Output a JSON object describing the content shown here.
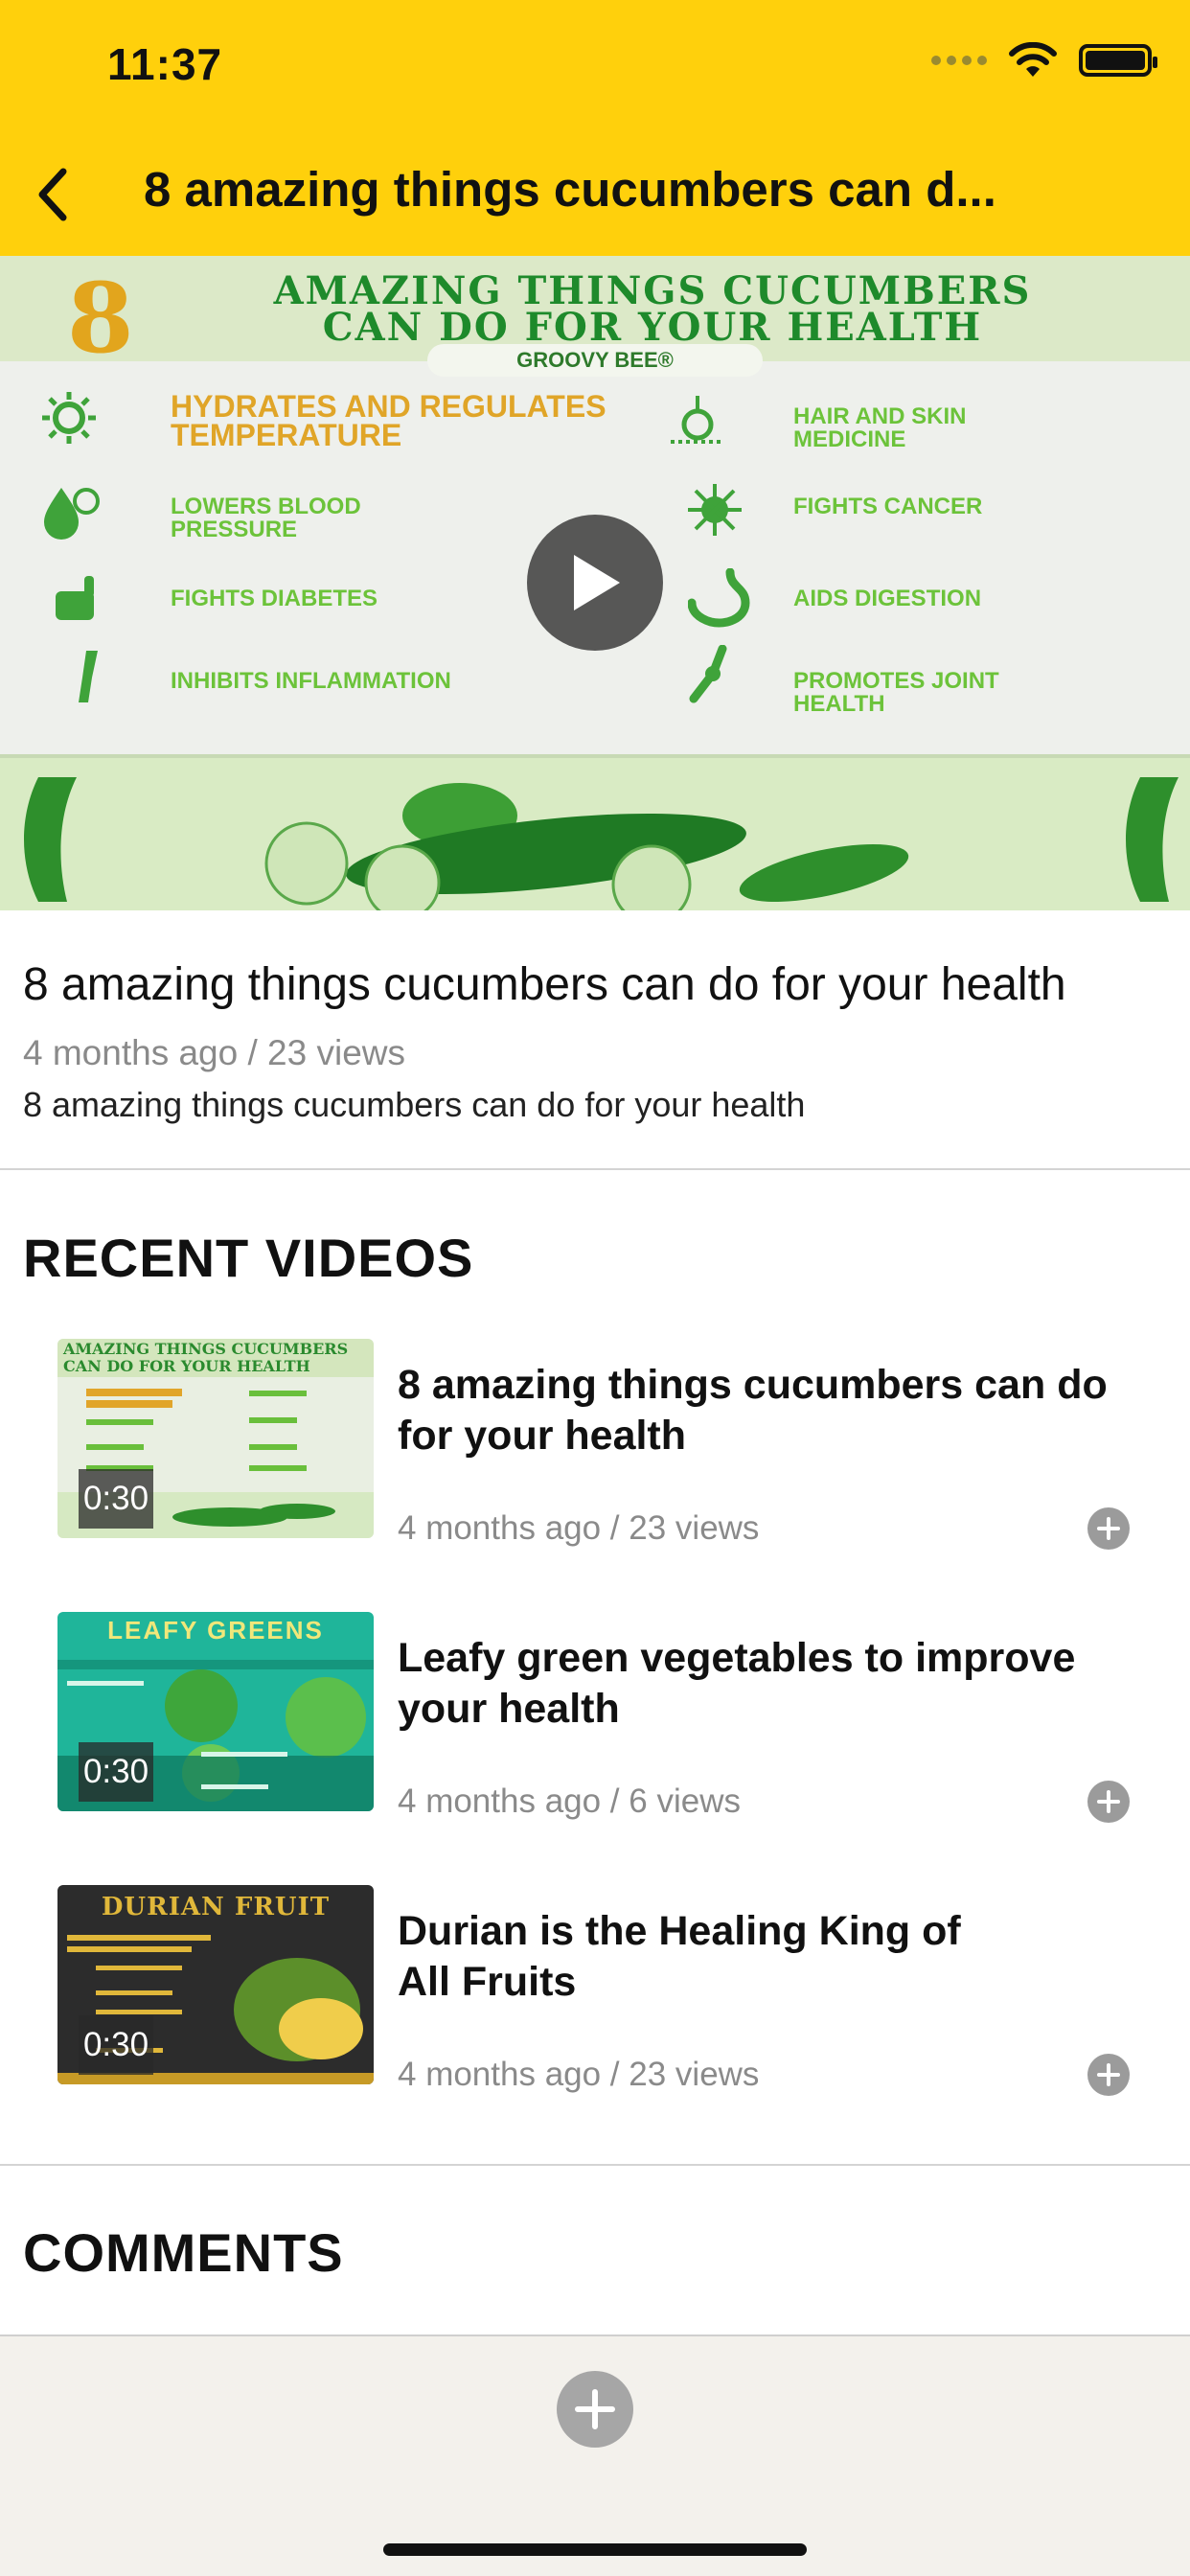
{
  "status_bar": {
    "time": "11:37"
  },
  "nav": {
    "title": "8 amazing things cucumbers can d..."
  },
  "hero": {
    "poster": {
      "number": "8",
      "title_line1": "AMAZING THINGS CUCUMBERS",
      "title_line2": "CAN DO FOR YOUR HEALTH",
      "brand": "GROOVY BEE®",
      "benefits_left": [
        "HYDRATES AND REGULATES TEMPERATURE",
        "LOWERS BLOOD PRESSURE",
        "FIGHTS DIABETES",
        "INHIBITS INFLAMMATION"
      ],
      "benefits_right": [
        "HAIR AND SKIN MEDICINE",
        "FIGHTS CANCER",
        "AIDS DIGESTION",
        "PROMOTES JOINT HEALTH"
      ]
    }
  },
  "video": {
    "title": "8 amazing things cucumbers can do for your health",
    "meta": "4 months ago / 23 views",
    "description": "8 amazing things cucumbers can do for your health"
  },
  "recent_videos": {
    "heading": "RECENT VIDEOS",
    "items": [
      {
        "title": "8 amazing things cucumbers can do for your health",
        "meta": "4 months ago / 23 views",
        "duration": "0:30",
        "thumb_title": "AMAZING THINGS CUCUMBERS CAN DO FOR YOUR HEALTH",
        "thumb_colors": [
          "#e9efe2",
          "#2a8a2e"
        ]
      },
      {
        "title": "Leafy green vegetables to improve your health",
        "meta": "4 months ago / 6 views",
        "duration": "0:30",
        "thumb_title": "LEAFY GREENS",
        "thumb_colors": [
          "#1fb59a",
          "#0e6b55"
        ]
      },
      {
        "title": "Durian is the Healing King of All Fruits",
        "meta": "4 months ago / 23 views",
        "duration": "0:30",
        "thumb_title": "DURIAN FRUIT",
        "thumb_colors": [
          "#2c2c2c",
          "#e0b73a"
        ]
      }
    ]
  },
  "comments": {
    "heading": "COMMENTS"
  },
  "colors": {
    "header": "#FFD00C",
    "accent_green": "#2a8a2e"
  }
}
